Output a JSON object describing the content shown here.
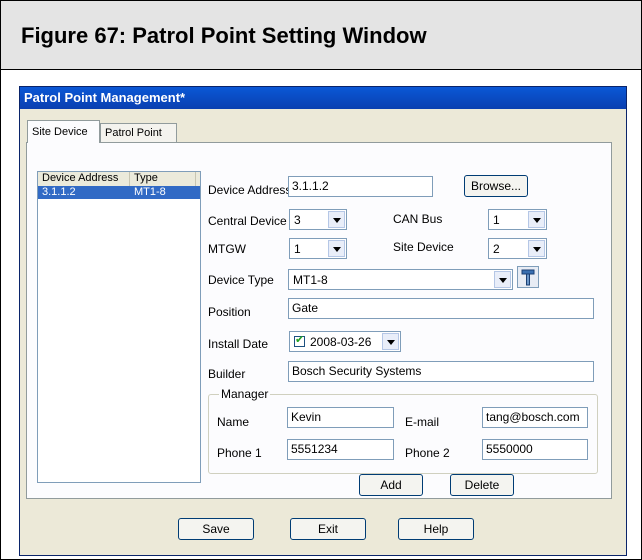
{
  "figure": {
    "title": "Figure 67:  Patrol Point Setting Window"
  },
  "window": {
    "title": "Patrol Point Management*"
  },
  "tabs": [
    {
      "label": "Site Device",
      "active": true
    },
    {
      "label": "Patrol Point",
      "active": false
    }
  ],
  "device_list": {
    "columns": [
      "Device Address",
      "Type"
    ],
    "rows": [
      {
        "address": "3.1.1.2",
        "type": "MT1-8",
        "selected": true
      }
    ]
  },
  "form": {
    "device_address": {
      "label": "Device Address",
      "value": "3.1.1.2"
    },
    "browse_button": "Browse...",
    "central_device": {
      "label": "Central Device",
      "value": "3"
    },
    "can_bus": {
      "label": "CAN Bus",
      "value": "1"
    },
    "mtgw": {
      "label": "MTGW",
      "value": "1"
    },
    "site_device": {
      "label": "Site Device",
      "value": "2"
    },
    "device_type": {
      "label": "Device Type",
      "value": "MT1-8"
    },
    "position": {
      "label": "Position",
      "value": "Gate"
    },
    "install_date": {
      "label": "Install Date",
      "value": "2008-03-26",
      "checked": true
    },
    "builder": {
      "label": "Builder",
      "value": "Bosch Security Systems"
    }
  },
  "manager": {
    "title": "Manager",
    "name": {
      "label": "Name",
      "value": "Kevin"
    },
    "email": {
      "label": "E-mail",
      "value": "tang@bosch.com"
    },
    "phone1": {
      "label": "Phone 1",
      "value": "5551234"
    },
    "phone2": {
      "label": "Phone 2",
      "value": "5550000"
    }
  },
  "panel_buttons": {
    "add": "Add",
    "delete": "Delete"
  },
  "footer_buttons": {
    "save": "Save",
    "exit": "Exit",
    "help": "Help"
  },
  "icons": {
    "device_type_tool": "hammer-icon",
    "dropdown": "chevron-down-icon",
    "checkbox": "checkmark-icon"
  },
  "colors": {
    "titlebar": "#0a4cc4",
    "selection": "#316ac5",
    "dialog_bg": "#ece9d8"
  }
}
